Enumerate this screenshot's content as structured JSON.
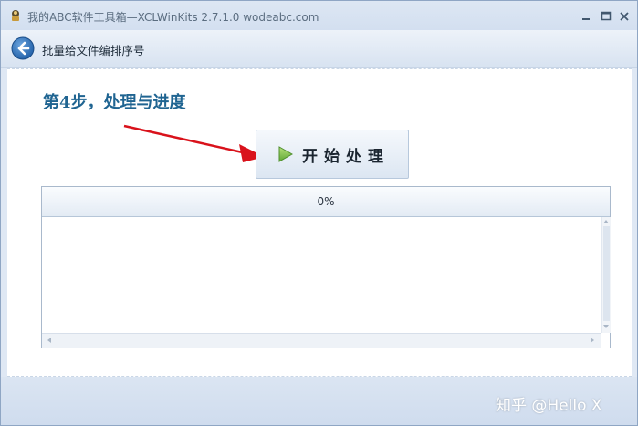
{
  "window": {
    "title": "我的ABC软件工具箱—XCLWinKits 2.7.1.0  wodeabc.com",
    "min_icon": "minimize-icon",
    "max_icon": "maximize-icon",
    "close_icon": "close-icon"
  },
  "nav": {
    "back_icon": "back-arrow-icon",
    "title": "批量给文件编排序号"
  },
  "step": {
    "title": "第4步，处理与进度"
  },
  "start_button": {
    "label": "开始处理",
    "icon": "play-icon",
    "icon_color": "#7cc24a"
  },
  "progress": {
    "text": "0%",
    "value": 0
  },
  "watermark": {
    "text": "知乎 @Hello X"
  },
  "colors": {
    "step_title": "#1f6491",
    "annotation_arrow": "#d9121b"
  }
}
